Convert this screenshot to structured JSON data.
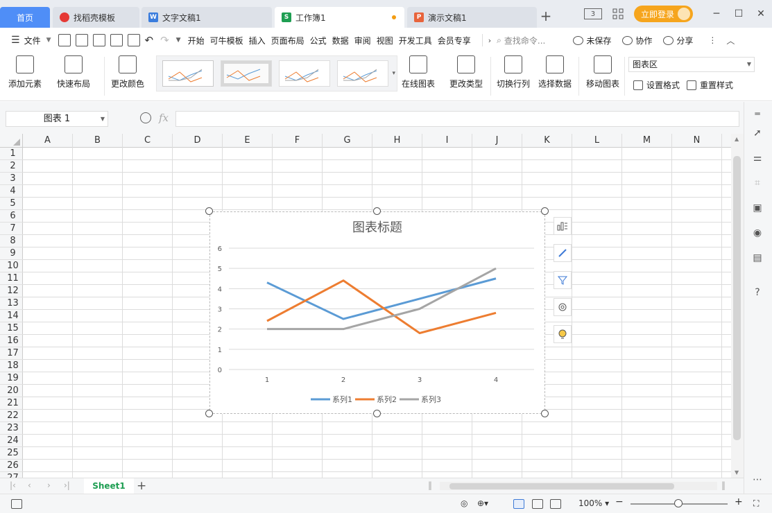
{
  "tabs": {
    "home": "首页",
    "daoke": "找稻壳模板",
    "doc": "文字文稿1",
    "book": "工作簿1",
    "ppt": "演示文稿1",
    "book_icon": "S",
    "doc_icon": "W",
    "ppt_icon": "P"
  },
  "topbar": {
    "login": "立即登录",
    "badge": "3"
  },
  "menu": {
    "file": "文件",
    "items": [
      "开始",
      "可牛模板",
      "插入",
      "页面布局",
      "公式",
      "数据",
      "审阅",
      "视图",
      "开发工具",
      "会员专享"
    ],
    "search": "查找命令...",
    "unsaved": "未保存",
    "collab": "协作",
    "share": "分享"
  },
  "ribbon": {
    "add_element": "添加元素",
    "quick_layout": "快速布局",
    "change_color": "更改颜色",
    "online_chart": "在线图表",
    "change_type": "更改类型",
    "switch_rowcol": "切换行列",
    "select_data": "选择数据",
    "move_chart": "移动图表",
    "chart_area": "图表区",
    "set_format": "设置格式",
    "reset_style": "重置样式"
  },
  "formula": {
    "namebox": "图表 1",
    "fx": "fx",
    "value": ""
  },
  "grid": {
    "columns": [
      "A",
      "B",
      "C",
      "D",
      "E",
      "F",
      "G",
      "H",
      "I",
      "J",
      "K",
      "L",
      "M",
      "N"
    ],
    "rows": [
      "1",
      "2",
      "3",
      "4",
      "5",
      "6",
      "7",
      "8",
      "9",
      "10",
      "11",
      "12",
      "13",
      "14",
      "15",
      "16",
      "17",
      "18",
      "19",
      "20",
      "21",
      "22",
      "23",
      "24",
      "25",
      "26",
      "27"
    ]
  },
  "chart_data": {
    "type": "line",
    "title": "图表标题",
    "categories": [
      "1",
      "2",
      "3",
      "4"
    ],
    "ylim": [
      0,
      6
    ],
    "yticks": [
      "0",
      "1",
      "2",
      "3",
      "4",
      "5",
      "6"
    ],
    "grid": true,
    "legend_position": "bottom",
    "series": [
      {
        "name": "系列1",
        "color": "#5b9bd5",
        "values": [
          4.3,
          2.5,
          3.5,
          4.5
        ]
      },
      {
        "name": "系列2",
        "color": "#ed7d31",
        "values": [
          2.4,
          4.4,
          1.8,
          2.8
        ]
      },
      {
        "name": "系列3",
        "color": "#a5a5a5",
        "values": [
          2.0,
          2.0,
          3.0,
          5.0
        ]
      }
    ]
  },
  "sheetbar": {
    "sheet": "Sheet1",
    "add": "+"
  },
  "status": {
    "zoom": "100%"
  },
  "colors": {
    "accent": "#4f8ef7",
    "sheet_tab_green": "#1e9e52",
    "login_orange": "#f6a51d"
  }
}
